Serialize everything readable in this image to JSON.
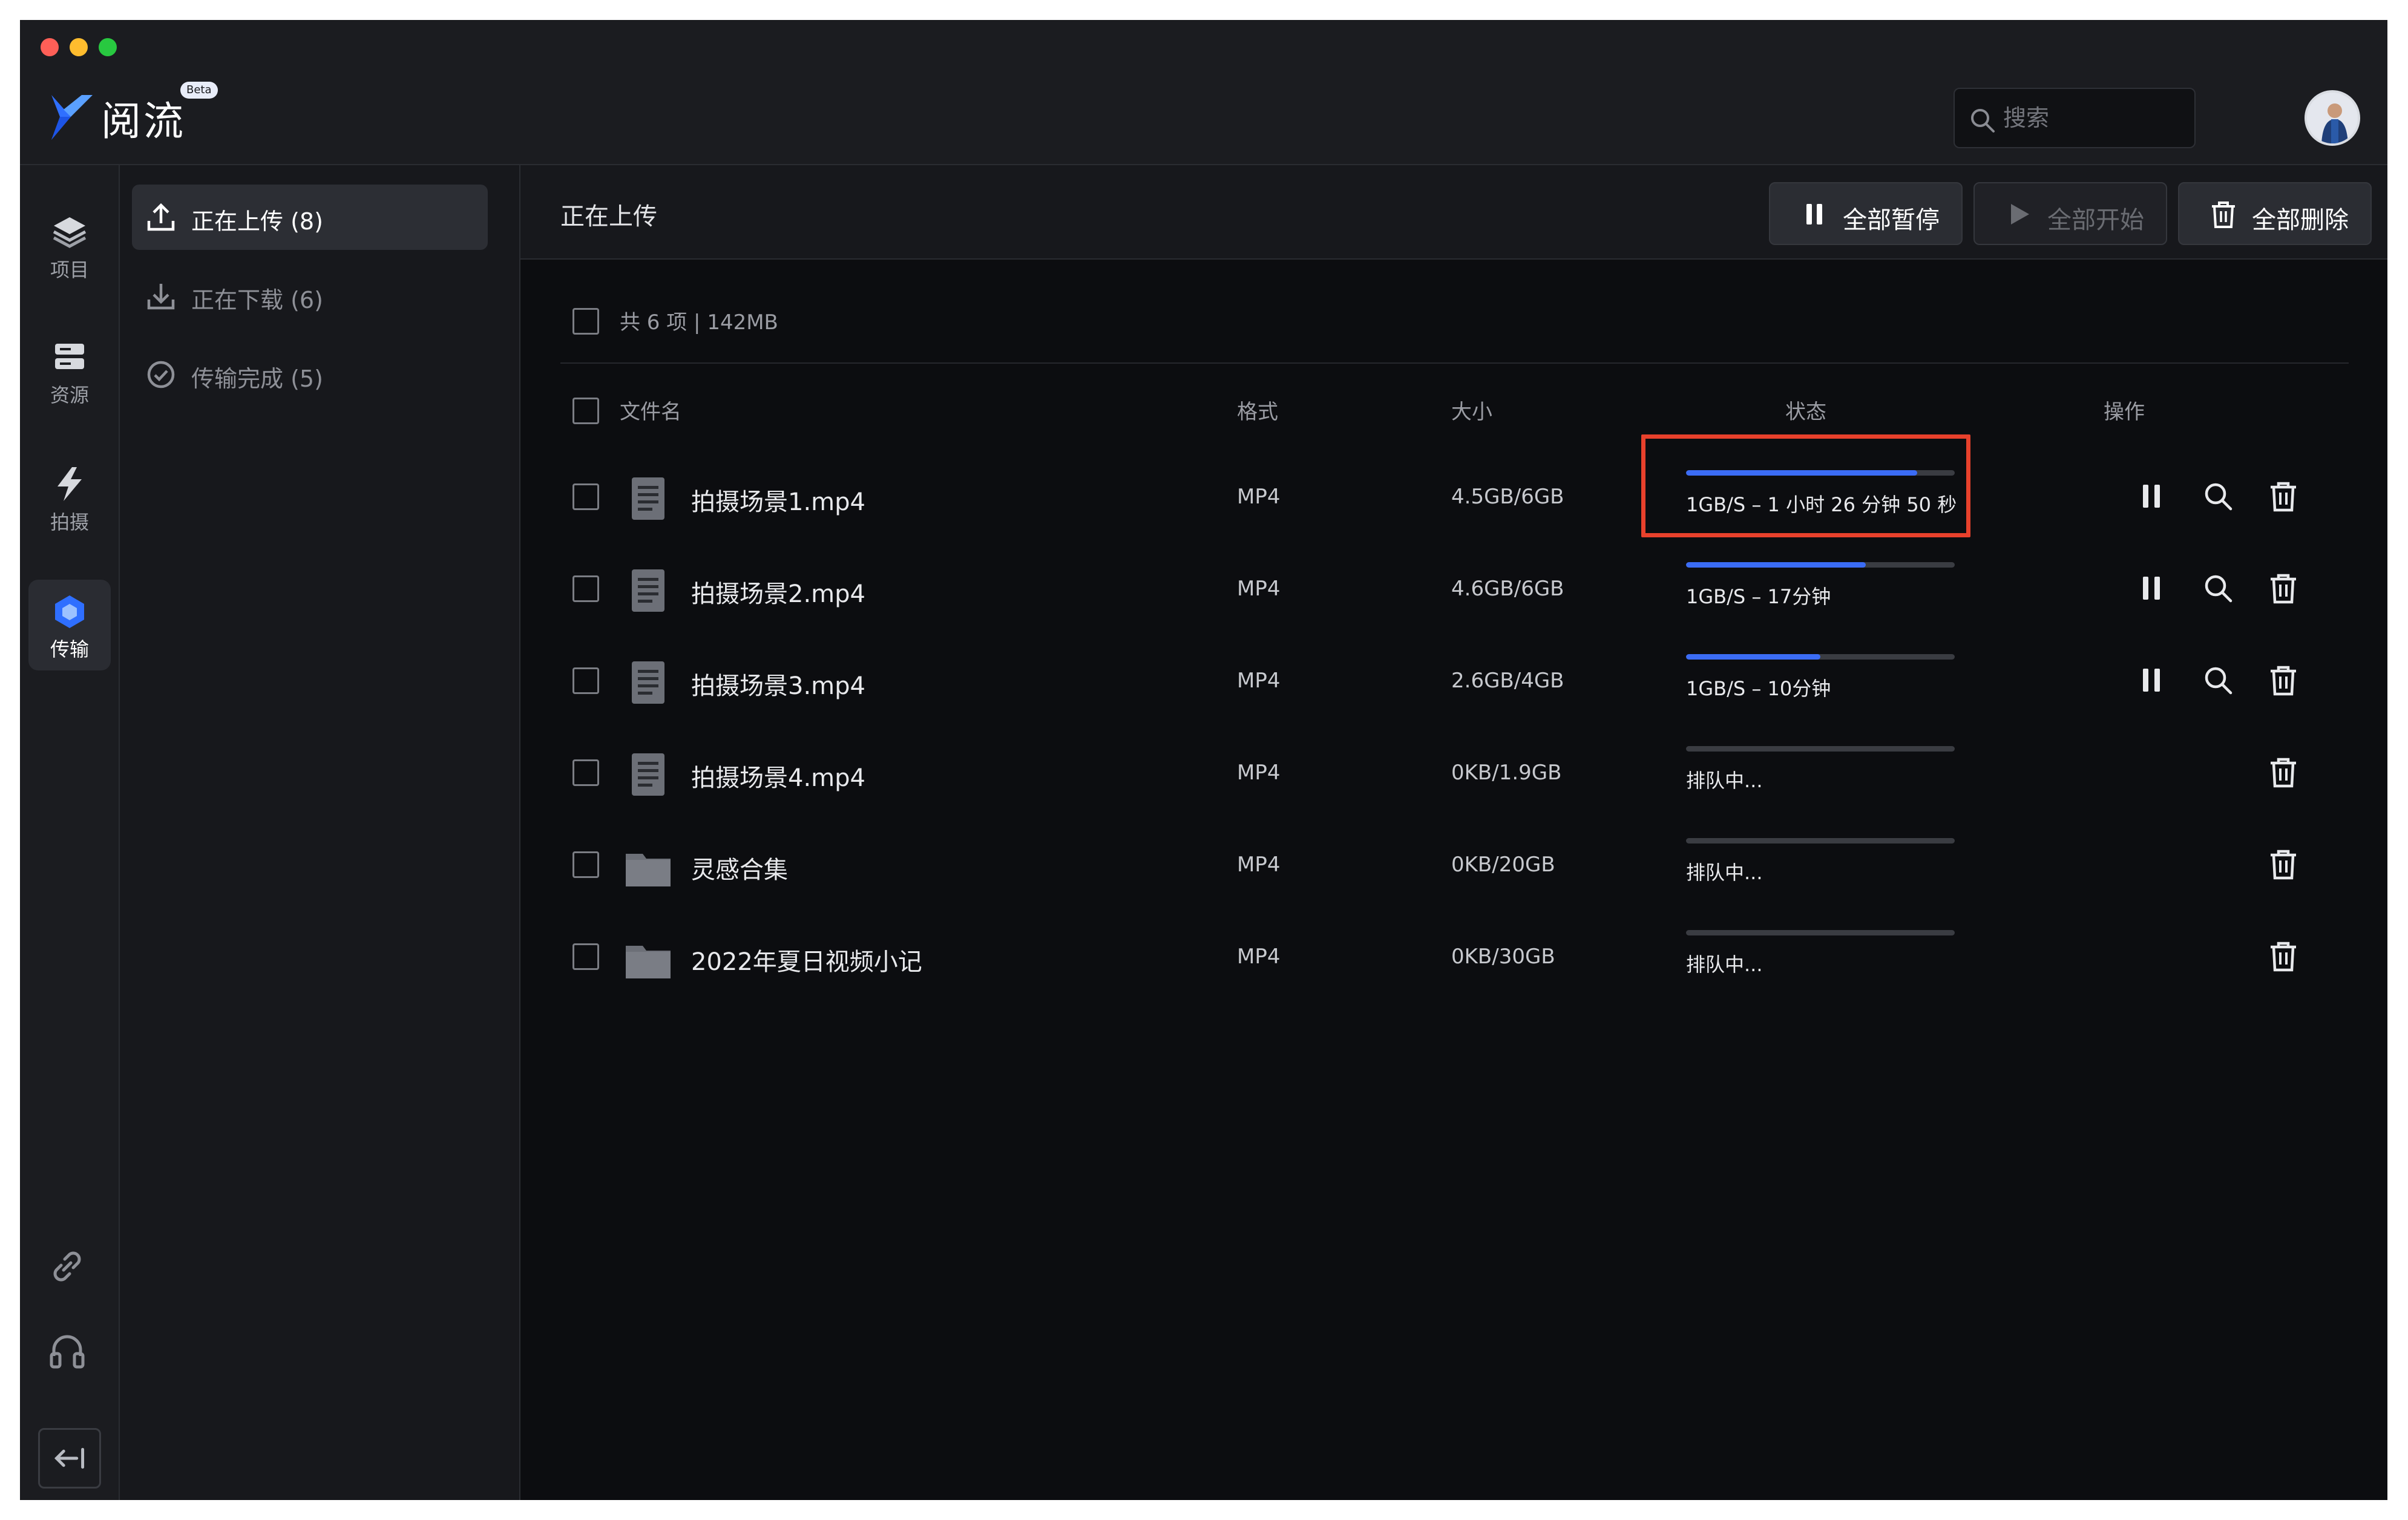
{
  "app": {
    "name": "阅流",
    "badge": "Beta",
    "search_placeholder": "搜索",
    "accent_color": "#3b6cf5",
    "highlight_color": "#e8412c"
  },
  "rail": {
    "items": [
      {
        "label": "项目",
        "icon": "layers-icon"
      },
      {
        "label": "资源",
        "icon": "storage-icon"
      },
      {
        "label": "拍摄",
        "icon": "lightning-icon"
      },
      {
        "label": "传输",
        "icon": "transfer-icon",
        "active": true
      }
    ],
    "bottom": [
      "link-icon",
      "headset-icon",
      "collapse-icon"
    ]
  },
  "nav": {
    "items": [
      {
        "label": "正在上传 (8)",
        "icon": "upload-icon",
        "active": true
      },
      {
        "label": "正在下载 (6)",
        "icon": "download-icon"
      },
      {
        "label": "传输完成 (5)",
        "icon": "check-circle-icon"
      }
    ]
  },
  "toolbar": {
    "title": "正在上传",
    "pause_all": "全部暂停",
    "start_all": "全部开始",
    "delete_all": "全部删除"
  },
  "summary": "共 6 项 | 142MB",
  "table": {
    "headers": {
      "name": "文件名",
      "format": "格式",
      "size": "大小",
      "status": "状态",
      "actions": "操作"
    },
    "rows": [
      {
        "name": "拍摄场景1.mp4",
        "type": "file",
        "format": "MP4",
        "size": "4.5GB/6GB",
        "progress": 0.86,
        "status": "1GB/S – 1 小时 26 分钟 50 秒",
        "actions": [
          "pause",
          "search",
          "delete"
        ]
      },
      {
        "name": "拍摄场景2.mp4",
        "type": "file",
        "format": "MP4",
        "size": "4.6GB/6GB",
        "progress": 0.67,
        "status": "1GB/S – 17分钟",
        "actions": [
          "pause",
          "search",
          "delete"
        ]
      },
      {
        "name": "拍摄场景3.mp4",
        "type": "file",
        "format": "MP4",
        "size": "2.6GB/4GB",
        "progress": 0.5,
        "status": "1GB/S – 10分钟",
        "actions": [
          "pause",
          "search",
          "delete"
        ]
      },
      {
        "name": "拍摄场景4.mp4",
        "type": "file",
        "format": "MP4",
        "size": "0KB/1.9GB",
        "progress": 0,
        "status": "排队中...",
        "actions": [
          "delete"
        ]
      },
      {
        "name": "灵感合集",
        "type": "folder",
        "format": "MP4",
        "size": "0KB/20GB",
        "progress": 0,
        "status": "排队中...",
        "actions": [
          "delete"
        ]
      },
      {
        "name": "2022年夏日视频小记",
        "type": "folder",
        "format": "MP4",
        "size": "0KB/30GB",
        "progress": 0,
        "status": "排队中...",
        "actions": [
          "delete"
        ]
      }
    ]
  }
}
